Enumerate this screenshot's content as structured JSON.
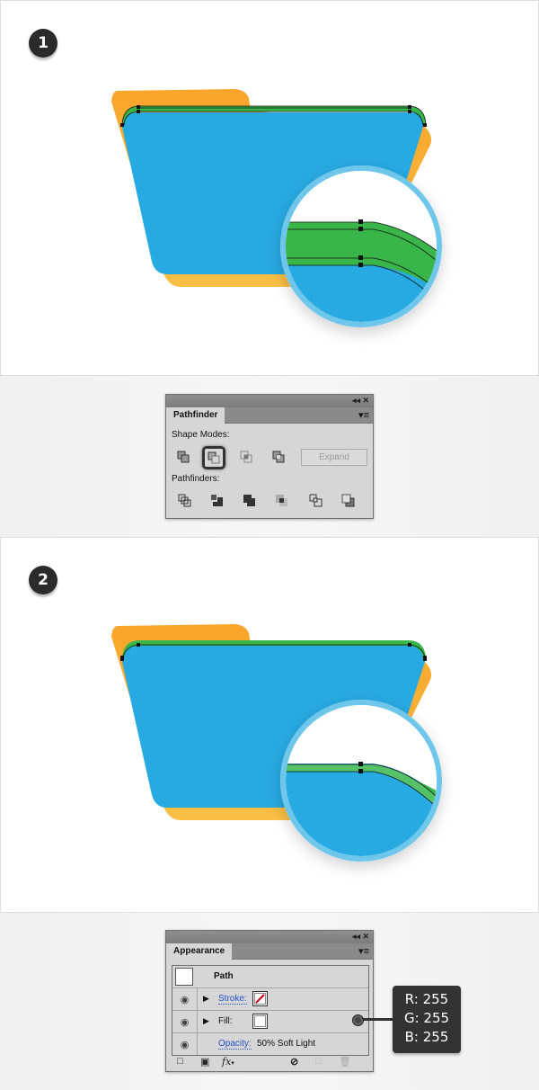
{
  "steps": [
    {
      "number": "1"
    },
    {
      "number": "2"
    }
  ],
  "colors": {
    "folder_back": "#f9a52b",
    "folder_front": "#27a9e1",
    "green_stroke": "#39b54a",
    "light_green": "#55c26a",
    "magnifier_ring": "#55bde8",
    "badge": "#2b2b2b"
  },
  "pathfinder_panel": {
    "tab_label": "Pathfinder",
    "collapse_icon": "double-arrow-left-icon",
    "close_icon": "close-icon",
    "menu_icon": "panel-menu-icon",
    "shape_modes_label": "Shape Modes:",
    "shape_modes": [
      {
        "name": "unite",
        "active": false
      },
      {
        "name": "minus-front",
        "active": true
      },
      {
        "name": "intersect",
        "active": false
      },
      {
        "name": "exclude",
        "active": false
      }
    ],
    "expand_label": "Expand",
    "pathfinders_label": "Pathfinders:",
    "pathfinders": [
      "divide",
      "trim",
      "merge",
      "crop",
      "outline",
      "minus-back"
    ]
  },
  "appearance_panel": {
    "tab_label": "Appearance",
    "path_label": "Path",
    "rows": [
      {
        "label": "Stroke:",
        "link": true,
        "swatch": "none"
      },
      {
        "label": "Fill:",
        "link": false,
        "swatch": "#ffffff"
      },
      {
        "label": "Opacity:",
        "link": true,
        "value": "50% Soft Light"
      }
    ],
    "bottom_icons": [
      "add-stroke-icon",
      "add-fill-icon",
      "fx-icon",
      "clear-icon",
      "duplicate-icon",
      "delete-icon"
    ],
    "fx_label": "fx"
  },
  "rgb_callout": {
    "r": "R: 255",
    "g": "G: 255",
    "b": "B: 255"
  }
}
